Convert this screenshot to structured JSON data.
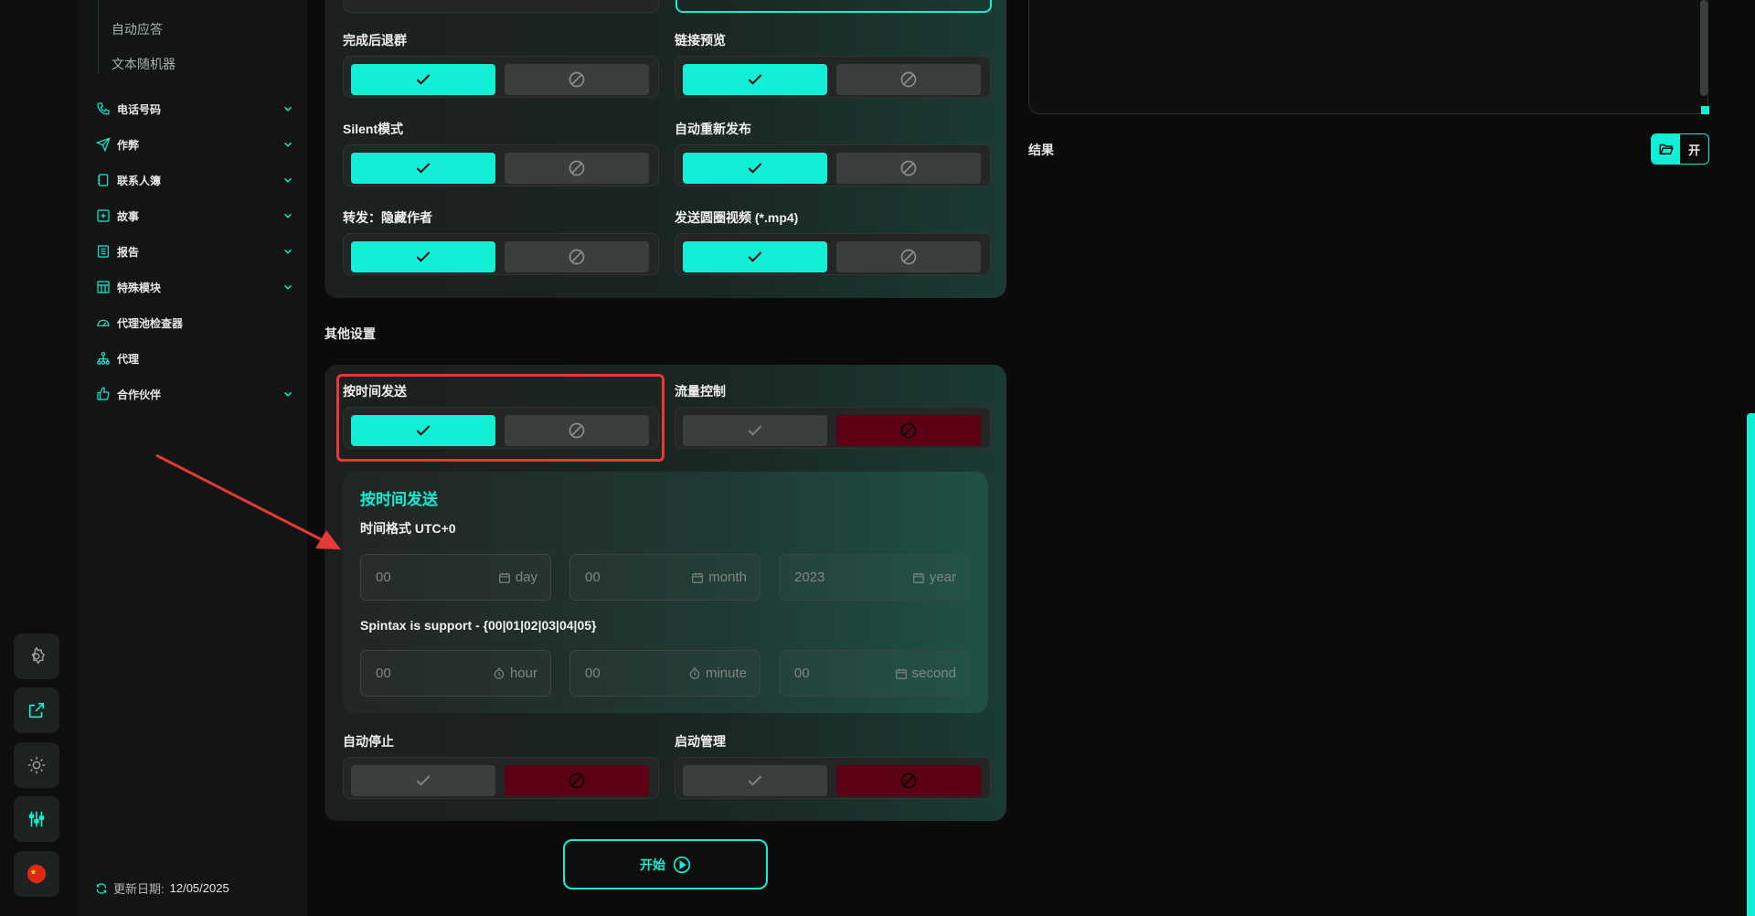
{
  "sidebar": {
    "sub_items": [
      "自动应答",
      "文本随机器"
    ],
    "items": [
      {
        "label": "电话号码",
        "icon": "phone-icon",
        "expandable": true
      },
      {
        "label": "作弊",
        "icon": "send-icon",
        "expandable": true
      },
      {
        "label": "联系人簿",
        "icon": "contacts-icon",
        "expandable": true
      },
      {
        "label": "故事",
        "icon": "story-plus-icon",
        "expandable": true
      },
      {
        "label": "报告",
        "icon": "report-icon",
        "expandable": true
      },
      {
        "label": "特殊模块",
        "icon": "module-icon",
        "expandable": true
      },
      {
        "label": "代理池检查器",
        "icon": "gauge-icon",
        "expandable": false
      },
      {
        "label": "代理",
        "icon": "network-icon",
        "expandable": false
      },
      {
        "label": "合作伙伴",
        "icon": "thumbs-up-icon",
        "expandable": true
      }
    ],
    "update_label": "更新日期:",
    "update_value": "12/05/2025"
  },
  "rail": {
    "buttons": [
      "settings-icon",
      "external-link-icon",
      "sun-icon",
      "sliders-icon",
      "china-flag-icon"
    ]
  },
  "options": {
    "leave_group": {
      "label": "完成后退群",
      "value": true
    },
    "link_preview": {
      "label": "链接预览",
      "value": true
    },
    "silent_mode": {
      "label": "Silent模式",
      "value": true
    },
    "auto_republish": {
      "label": "自动重新发布",
      "value": true
    },
    "forward_hide_author": {
      "label": "转发：隐藏作者",
      "value": true
    },
    "send_round_video": {
      "label": "发送圆圈视频 (*.mp4)",
      "value": true
    }
  },
  "other_settings": {
    "title": "其他设置",
    "send_by_time": {
      "label": "按时间发送",
      "value": true
    },
    "traffic_control": {
      "label": "流量控制",
      "value": false
    },
    "auto_stop": {
      "label": "自动停止",
      "value": false
    },
    "launch_management": {
      "label": "启动管理",
      "value": false
    }
  },
  "schedule": {
    "title": "按时间发送",
    "format_label": "时间格式 UTC+0",
    "spintax_label": "Spintax is support - {00|01|02|03|04|05}",
    "day": {
      "value": "00",
      "unit": "day"
    },
    "month": {
      "value": "00",
      "unit": "month"
    },
    "year": {
      "value": "2023",
      "unit": "year"
    },
    "hour": {
      "value": "00",
      "unit": "hour"
    },
    "minute": {
      "value": "00",
      "unit": "minute"
    },
    "second": {
      "value": "00",
      "unit": "second"
    }
  },
  "start_button": {
    "label": "开始"
  },
  "result": {
    "label": "结果",
    "toggle_label": "开"
  },
  "colors": {
    "accent": "#12efd6",
    "danger": "#5e0013",
    "highlight": "#e53935"
  }
}
